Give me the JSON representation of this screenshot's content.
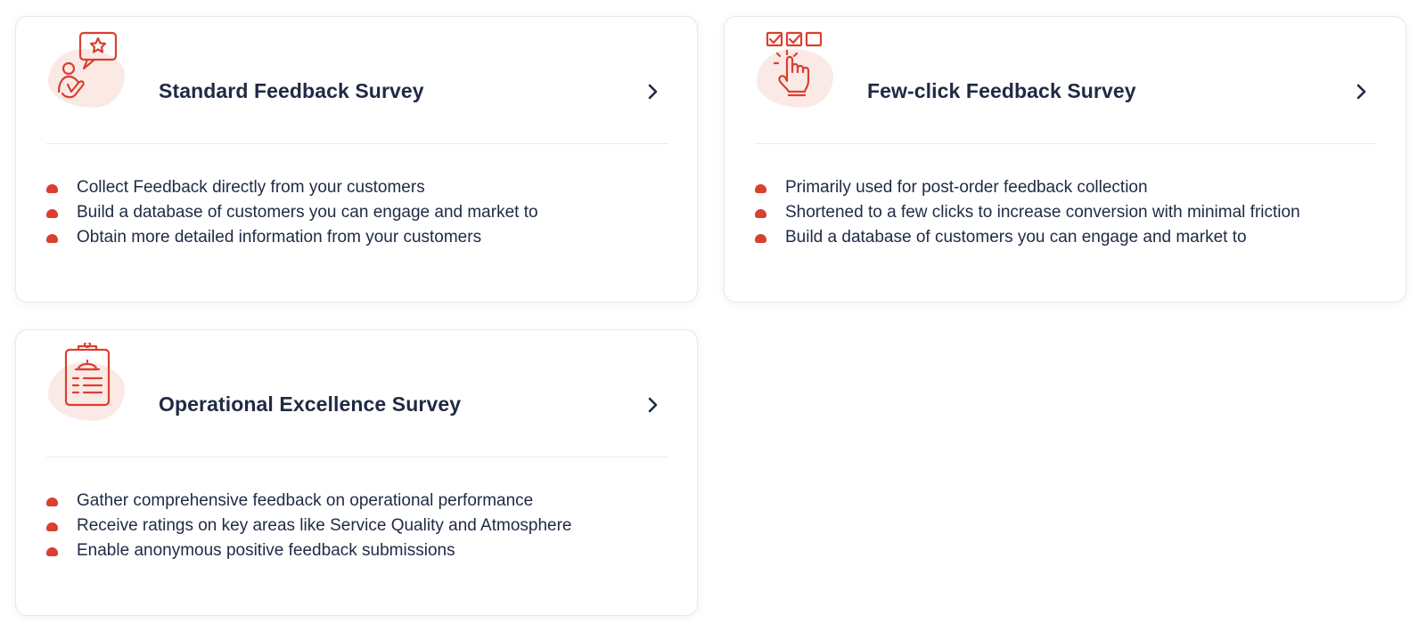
{
  "accent_color": "#d9402f",
  "cards": [
    {
      "title": "Standard Feedback Survey",
      "icon": "feedback-person-star-icon",
      "bullets": [
        "Collect Feedback directly from your customers",
        "Build a database of customers you can engage and market to",
        "Obtain more detailed information from your customers"
      ]
    },
    {
      "title": "Few-click Feedback Survey",
      "icon": "checkbox-click-icon",
      "bullets": [
        "Primarily used for post-order feedback collection",
        "Shortened to a few clicks to increase conversion with minimal friction",
        "Build a database of customers you can engage and market to"
      ]
    },
    {
      "title": "Operational Excellence Survey",
      "icon": "clipboard-bell-icon",
      "bullets": [
        "Gather comprehensive feedback on operational performance",
        "Receive ratings on key areas like Service Quality and Atmosphere",
        "Enable anonymous positive feedback submissions"
      ]
    }
  ]
}
